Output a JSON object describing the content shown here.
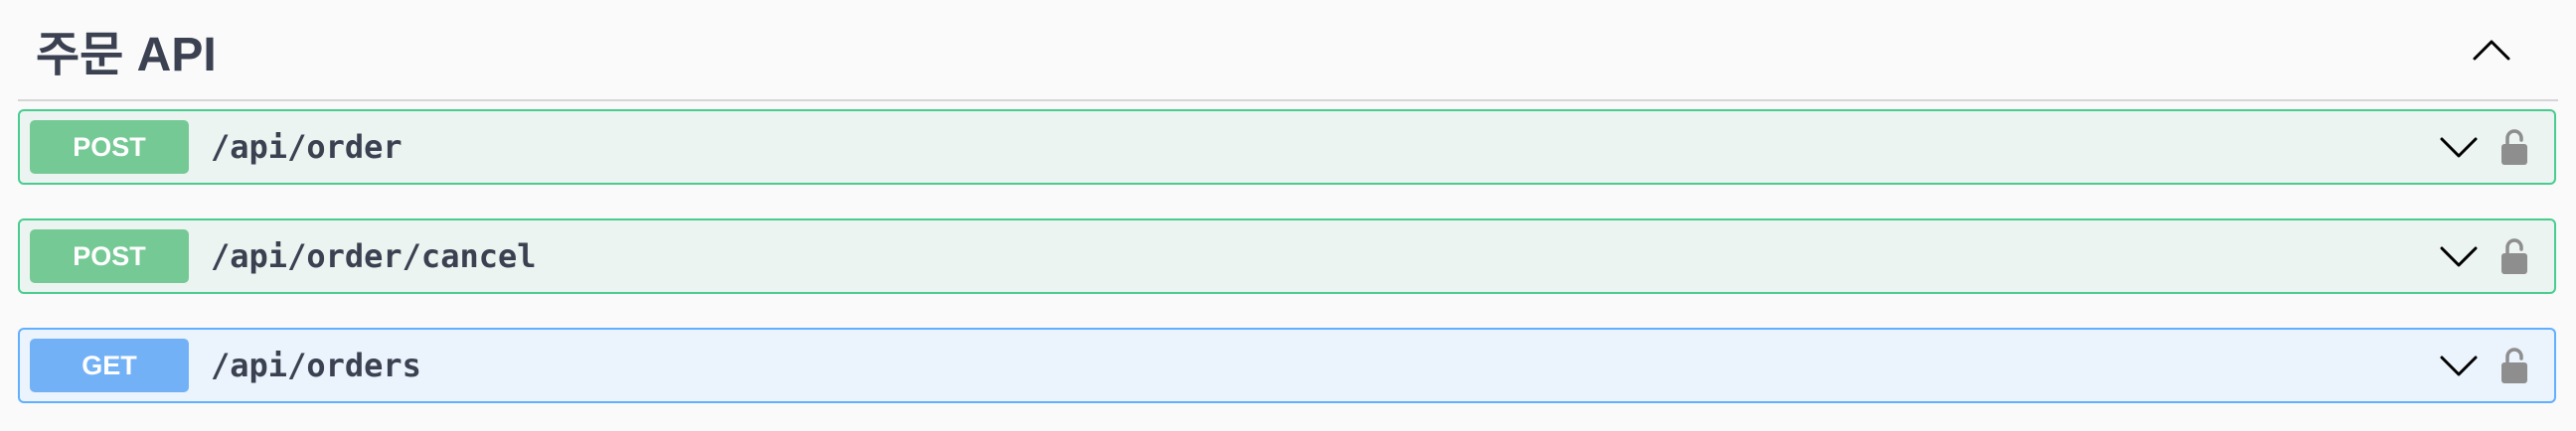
{
  "tag": {
    "title": "주문 API",
    "toggle_icon": "chevron-up-icon"
  },
  "operations": [
    {
      "method": "POST",
      "path": "/api/order",
      "expand_icon": "chevron-down-icon",
      "lock_icon": "unlocked-padlock-icon",
      "border_color": "#49cc90",
      "bg_color": "#ebf4f0"
    },
    {
      "method": "POST",
      "path": "/api/order/cancel",
      "expand_icon": "chevron-down-icon",
      "lock_icon": "unlocked-padlock-icon",
      "border_color": "#49cc90",
      "bg_color": "#ebf4f0"
    },
    {
      "method": "GET",
      "path": "/api/orders",
      "expand_icon": "chevron-down-icon",
      "lock_icon": "unlocked-padlock-icon",
      "border_color": "#61affe",
      "bg_color": "#ebf3fc"
    }
  ],
  "colors": {
    "post_badge": "#75c995",
    "get_badge": "#73b1f7",
    "text": "#3b4151",
    "icon": "#8e8e8e"
  }
}
